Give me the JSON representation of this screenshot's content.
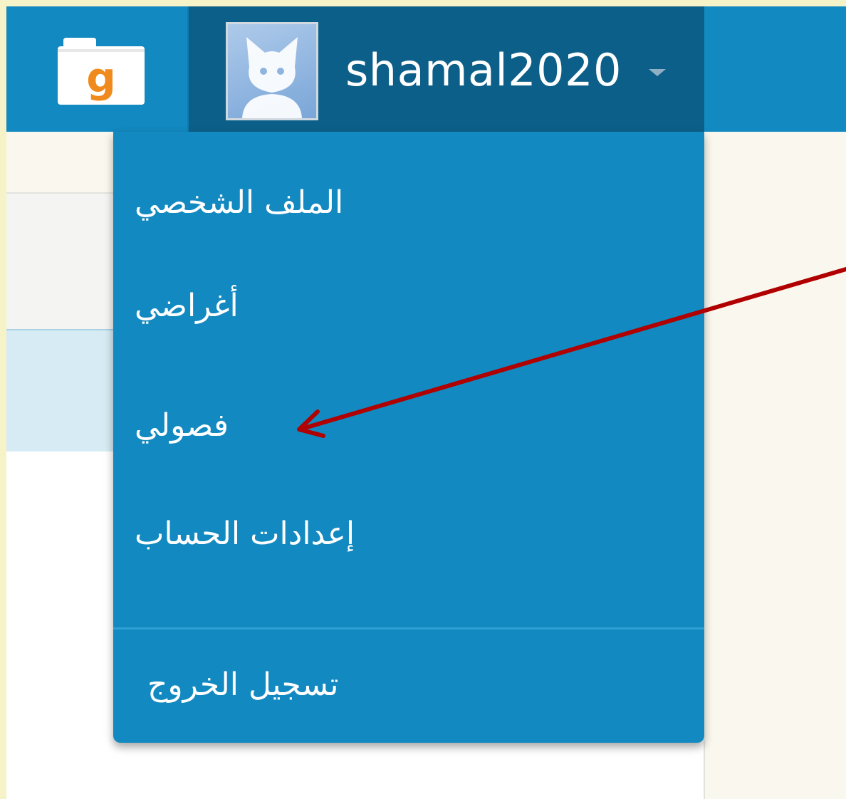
{
  "navbar": {
    "logo_icon": "folder-icon",
    "logo_letter": "g",
    "username": "shamal2020",
    "avatar_icon": "cat-avatar-icon",
    "caret_icon": "caret-down-icon"
  },
  "dropdown": {
    "items": [
      {
        "label": "الملف الشخصي"
      },
      {
        "label": "أغراضي"
      },
      {
        "label": "فصولي"
      },
      {
        "label": "إعدادات الحساب"
      }
    ],
    "logout_label": "تسجيل الخروج"
  },
  "colors": {
    "navbar": "#1289c0",
    "user_cell": "#0c5f88",
    "dropdown": "#1289c0",
    "annotation_arrow": "#b00000"
  }
}
